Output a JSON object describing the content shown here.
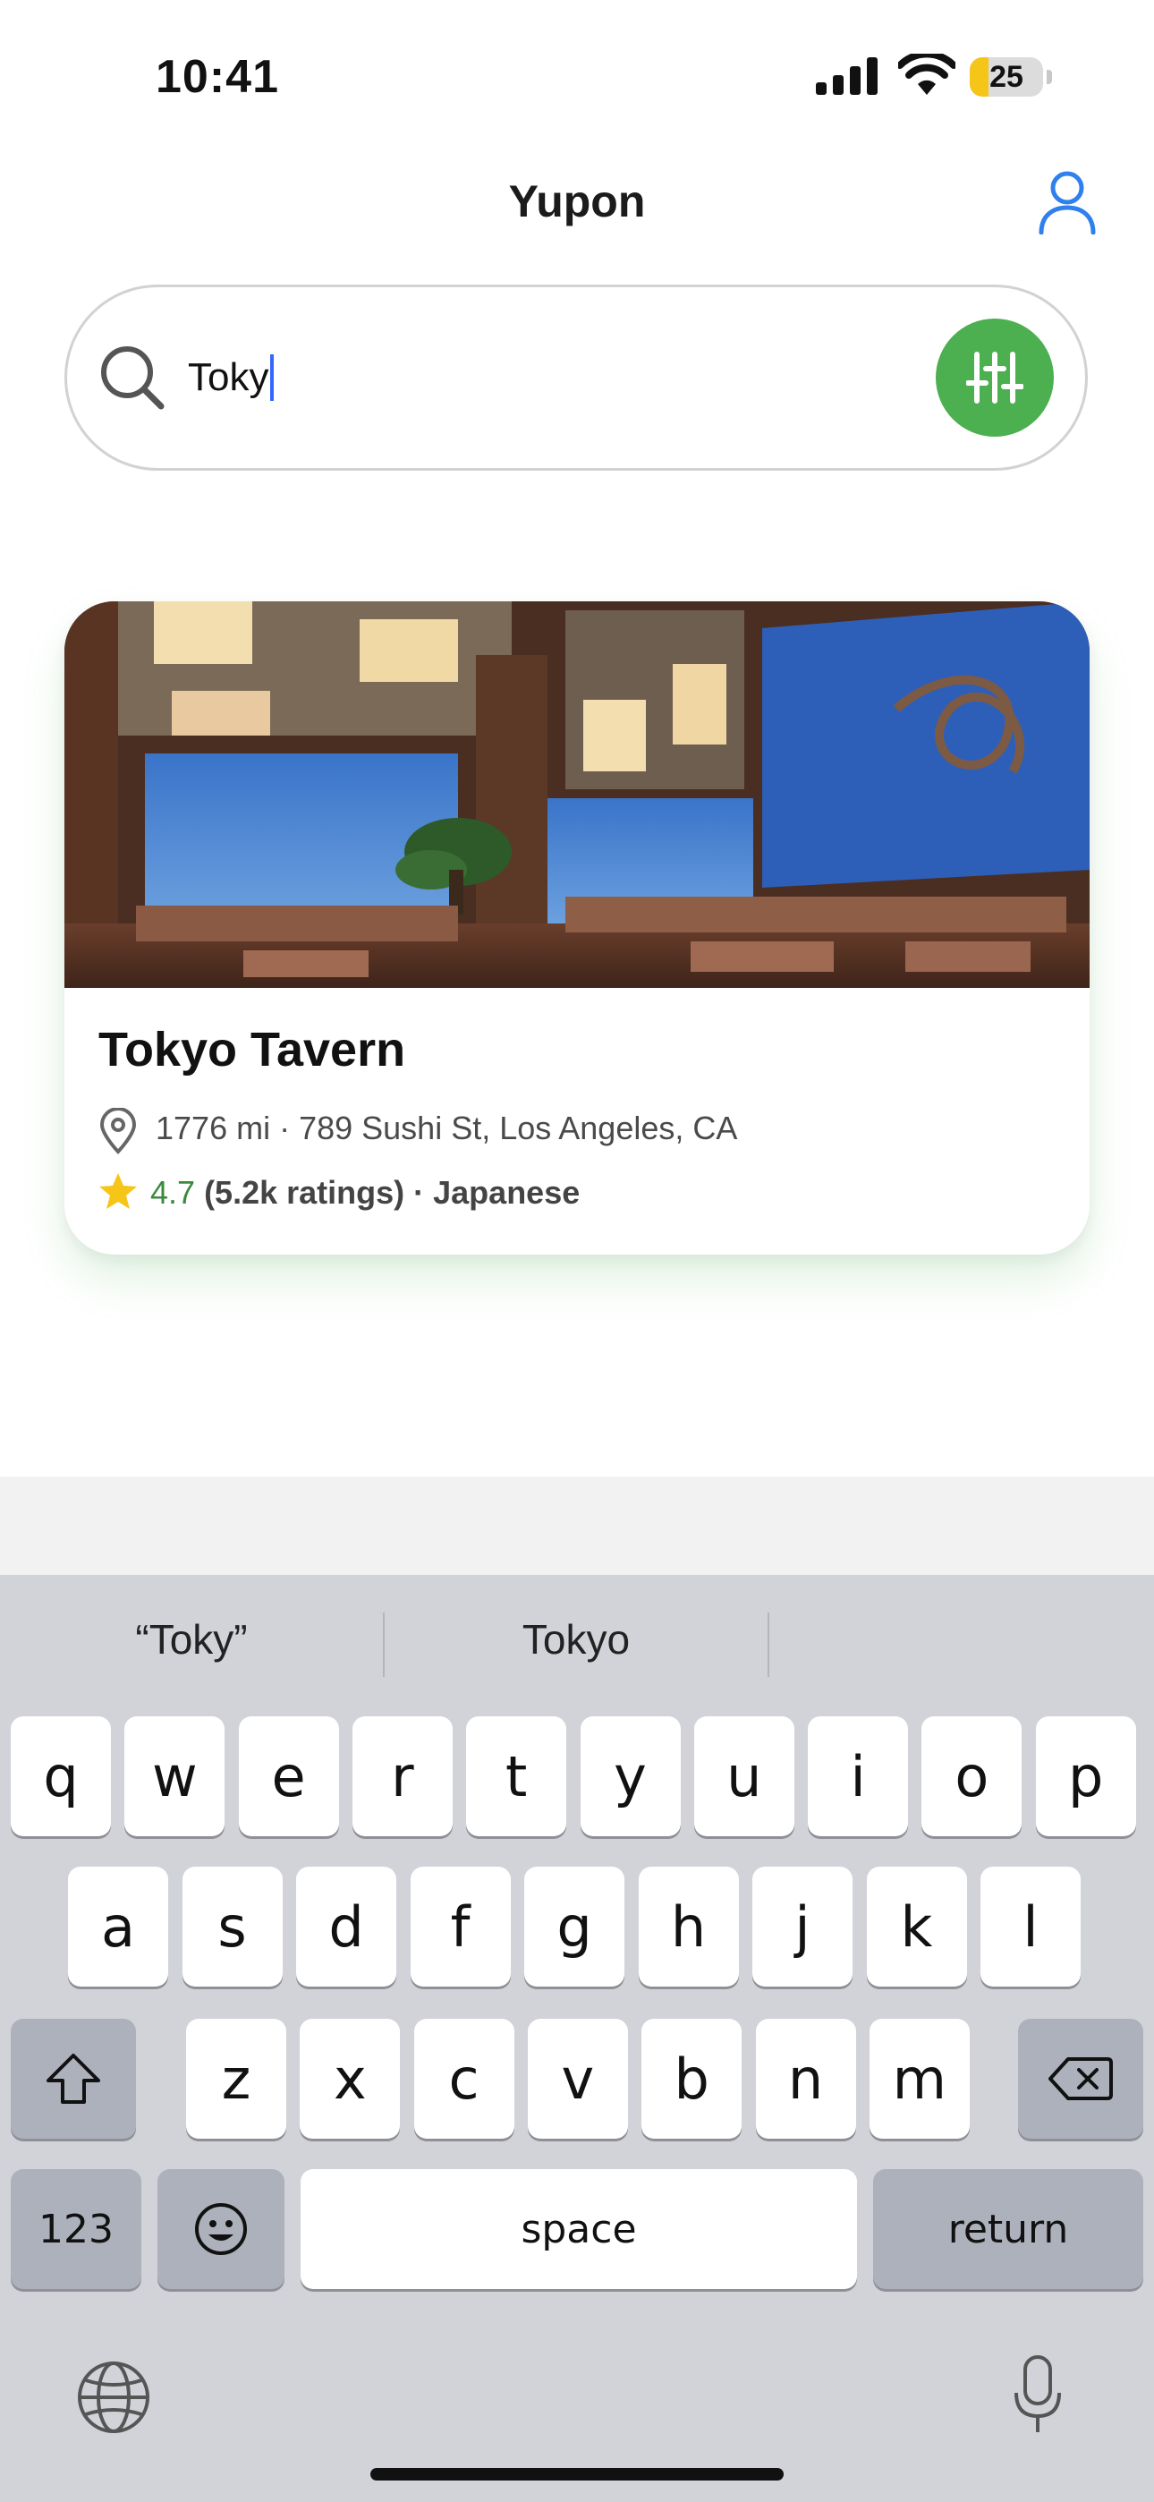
{
  "status_bar": {
    "time": "10:41",
    "battery_level": "25",
    "battery_fraction": 0.25,
    "battery_color": "#f5c518"
  },
  "header": {
    "title": "Yupon",
    "profile_icon": "person-icon",
    "accent_color": "#2f80ed"
  },
  "search": {
    "value": "Toky",
    "icon": "search-icon",
    "filter_icon": "sliders-icon",
    "filter_color": "#4caf50"
  },
  "results": [
    {
      "name": "Tokyo Tavern",
      "distance": "1776 mi",
      "separator": " · ",
      "address": "789 Sushi St, Los Angeles, CA",
      "rating": "4.7",
      "rating_count": "(5.2k ratings)",
      "cuisine": "Japanese",
      "image_icon": "restaurant-photo"
    }
  ],
  "keyboard": {
    "suggestions": [
      "“Toky”",
      "Tokyo",
      ""
    ],
    "row1": [
      "q",
      "w",
      "e",
      "r",
      "t",
      "y",
      "u",
      "i",
      "o",
      "p"
    ],
    "row2": [
      "a",
      "s",
      "d",
      "f",
      "g",
      "h",
      "j",
      "k",
      "l"
    ],
    "row3": [
      "z",
      "x",
      "c",
      "v",
      "b",
      "n",
      "m"
    ],
    "numbers_label": "123",
    "space_label": "space",
    "return_label": "return",
    "icons": [
      "shift-icon",
      "delete-icon",
      "emoji-icon",
      "globe-icon",
      "microphone-icon"
    ]
  }
}
